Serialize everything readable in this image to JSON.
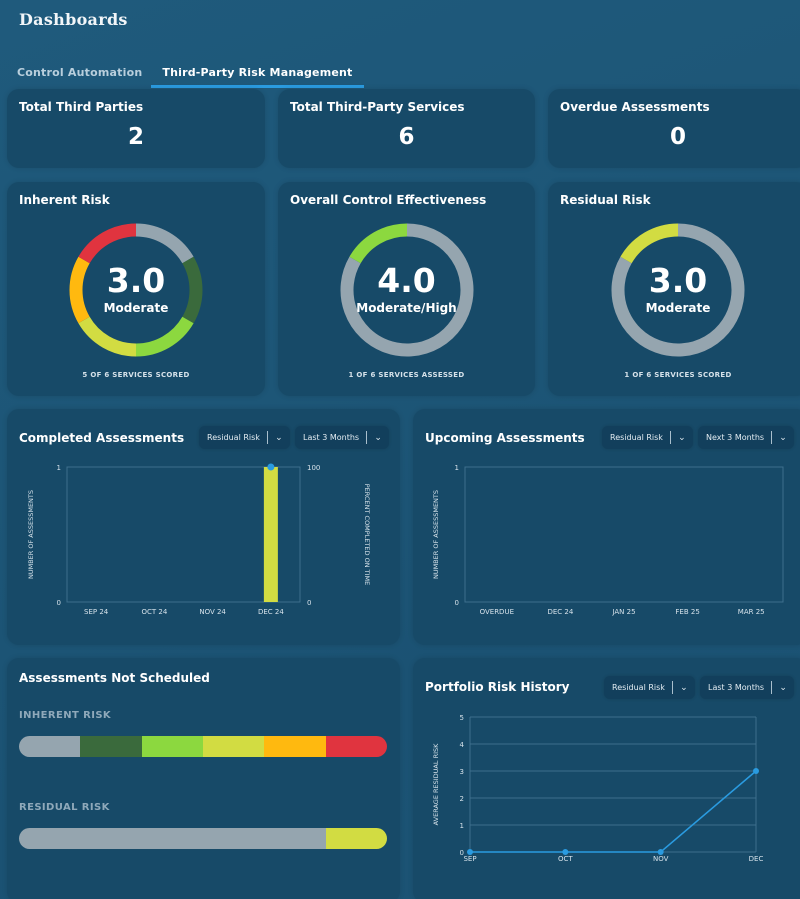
{
  "header": {
    "title": "Dashboards"
  },
  "tabs": [
    {
      "label": "Control Automation",
      "active": false
    },
    {
      "label": "Third-Party Risk Management",
      "active": true
    }
  ],
  "stats": [
    {
      "title": "Total Third Parties",
      "value": "2"
    },
    {
      "title": "Total Third-Party Services",
      "value": "6"
    },
    {
      "title": "Overdue Assessments",
      "value": "0"
    }
  ],
  "colors": {
    "unscored": "#95a5af",
    "low": "#3a6a3c",
    "low_moderate": "#8cd83f",
    "moderate": "#d2dc42",
    "moderate_high": "#ffb90f",
    "high": "#e0343f",
    "accent": "#2a9be0"
  },
  "donuts": [
    {
      "title": "Inherent Risk",
      "score": "3.0",
      "label": "Moderate",
      "footer": "5 OF 6 SERVICES SCORED",
      "segments": [
        {
          "name": "unscored",
          "count": 1,
          "color": "#95a5af"
        },
        {
          "name": "low",
          "count": 1,
          "color": "#3a6a3c"
        },
        {
          "name": "low-moderate",
          "count": 1,
          "color": "#8cd83f"
        },
        {
          "name": "moderate",
          "count": 1,
          "color": "#d2dc42"
        },
        {
          "name": "moderate-high",
          "count": 1,
          "color": "#ffb90f"
        },
        {
          "name": "high",
          "count": 1,
          "color": "#e0343f"
        }
      ]
    },
    {
      "title": "Overall Control Effectiveness",
      "score": "4.0",
      "label": "Moderate/High",
      "footer": "1 OF 6 SERVICES ASSESSED",
      "segments": [
        {
          "name": "unassessed",
          "count": 5,
          "color": "#95a5af"
        },
        {
          "name": "moderate-high",
          "count": 1,
          "color": "#8cd83f"
        }
      ]
    },
    {
      "title": "Residual Risk",
      "score": "3.0",
      "label": "Moderate",
      "footer": "1 OF 6 SERVICES SCORED",
      "segments": [
        {
          "name": "unscored",
          "count": 5,
          "color": "#95a5af"
        },
        {
          "name": "moderate",
          "count": 1,
          "color": "#d2dc42"
        }
      ]
    }
  ],
  "completed": {
    "title": "Completed Assessments",
    "filter": "Residual Risk",
    "range": "Last 3 Months",
    "chart_data": {
      "type": "bar",
      "title": "Completed Assessments",
      "categories": [
        "SEP 24",
        "OCT 24",
        "NOV 24",
        "DEC 24"
      ],
      "values": [
        0,
        0,
        0,
        1
      ],
      "bar_color": "#d2dc42",
      "ylabel": "NUMBER OF ASSESSMENTS",
      "ylim": [
        0,
        1
      ],
      "yticks": [
        "0",
        "1"
      ],
      "y2label": "PERCENT COMPLETED ON TIME",
      "y2lim": [
        0,
        100
      ],
      "y2ticks": [
        "0",
        "100"
      ],
      "on_time_points": [
        {
          "x": "DEC 24",
          "y": 100
        }
      ]
    }
  },
  "upcoming": {
    "title": "Upcoming Assessments",
    "filter": "Residual Risk",
    "range": "Next 3 Months",
    "chart_data": {
      "type": "bar",
      "title": "Upcoming Assessments",
      "categories": [
        "OVERDUE",
        "DEC 24",
        "JAN 25",
        "FEB 25",
        "MAR 25"
      ],
      "values": [
        0,
        0,
        0,
        0,
        0
      ],
      "ylabel": "NUMBER OF ASSESSMENTS",
      "ylim": [
        0,
        1
      ],
      "yticks": [
        "0",
        "1"
      ]
    }
  },
  "not_scheduled": {
    "title": "Assessments Not Scheduled",
    "inherent_label": "INHERENT RISK",
    "residual_label": "RESIDUAL RISK",
    "inherent": [
      {
        "name": "unscored",
        "count": 1,
        "color": "#95a5af"
      },
      {
        "name": "low",
        "count": 1,
        "color": "#3a6a3c"
      },
      {
        "name": "low-moderate",
        "count": 1,
        "color": "#8cd83f"
      },
      {
        "name": "moderate",
        "count": 1,
        "color": "#d2dc42"
      },
      {
        "name": "moderate-high",
        "count": 1,
        "color": "#ffb90f"
      },
      {
        "name": "high",
        "count": 1,
        "color": "#e0343f"
      }
    ],
    "residual": [
      {
        "name": "unscored",
        "count": 5,
        "color": "#95a5af"
      },
      {
        "name": "moderate",
        "count": 1,
        "color": "#d2dc42"
      }
    ]
  },
  "history": {
    "title": "Portfolio Risk History",
    "filter": "Residual Risk",
    "range": "Last 3 Months",
    "chart_data": {
      "type": "line",
      "title": "Portfolio Risk History",
      "x": [
        "SEP",
        "OCT",
        "NOV",
        "DEC"
      ],
      "series": [
        {
          "name": "Average Residual Risk",
          "values": [
            0,
            0,
            0,
            3
          ],
          "color": "#2a9be0"
        }
      ],
      "ylabel": "AVERAGE RESIDUAL RISK",
      "ylim": [
        0,
        5
      ],
      "yticks": [
        "0",
        "1",
        "2",
        "3",
        "4",
        "5"
      ],
      "grid": true
    }
  }
}
